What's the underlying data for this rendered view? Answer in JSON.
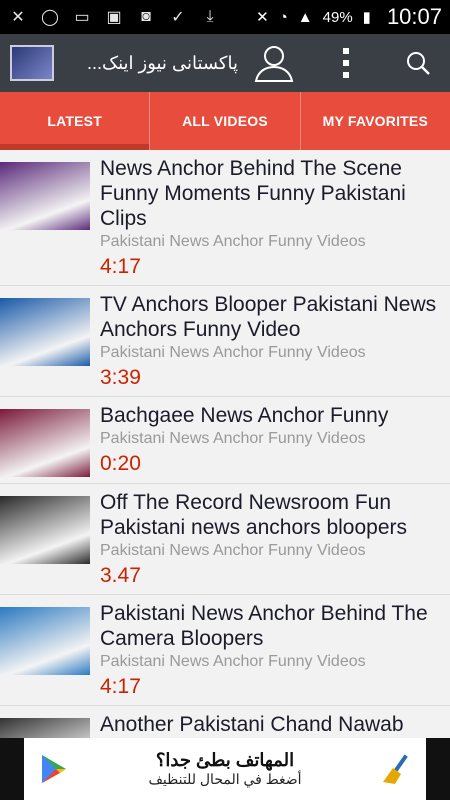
{
  "status": {
    "battery": "49%",
    "time": "10:07",
    "icons": [
      "close-icon",
      "whatsapp-icon",
      "chat-icon",
      "gallery-icon",
      "camera-icon",
      "check-icon",
      "download-icon"
    ]
  },
  "appbar": {
    "title": "پاکستانی نیوز اینک..."
  },
  "tabs": [
    {
      "label": "LATEST"
    },
    {
      "label": "ALL VIDEOS"
    },
    {
      "label": "MY FAVORITES"
    }
  ],
  "videos": [
    {
      "title": "News Anchor Behind The Scene Funny Moments Funny Pakistani Clips",
      "channel": "Pakistani News Anchor Funny Videos",
      "duration": "4:17",
      "thumb_color": "#5a2a7a"
    },
    {
      "title": "TV Anchors Blooper Pakistani News Anchors Funny Video",
      "channel": "Pakistani News Anchor Funny Videos",
      "duration": "3:39",
      "thumb_color": "#1a5aa8"
    },
    {
      "title": "Bachgaee News Anchor Funny",
      "channel": "Pakistani News Anchor Funny Videos",
      "duration": "0:20",
      "thumb_color": "#7a1a3a"
    },
    {
      "title": "Off The Record Newsroom Fun Pakistani news anchors bloopers",
      "channel": "Pakistani News Anchor Funny Videos",
      "duration": "3.47",
      "thumb_color": "#2a2a2a"
    },
    {
      "title": "Pakistani News Anchor Behind The Camera Bloopers",
      "channel": "Pakistani News Anchor Funny Videos",
      "duration": "4:17",
      "thumb_color": "#2b7ac0"
    },
    {
      "title": "Another Pakistani Chand Nawab",
      "channel": "",
      "duration": "",
      "thumb_color": "#333333"
    }
  ],
  "ad": {
    "title": "المهاتف بطئ جدا؟",
    "subtitle": "أضغط في المحال للتنظيف"
  }
}
